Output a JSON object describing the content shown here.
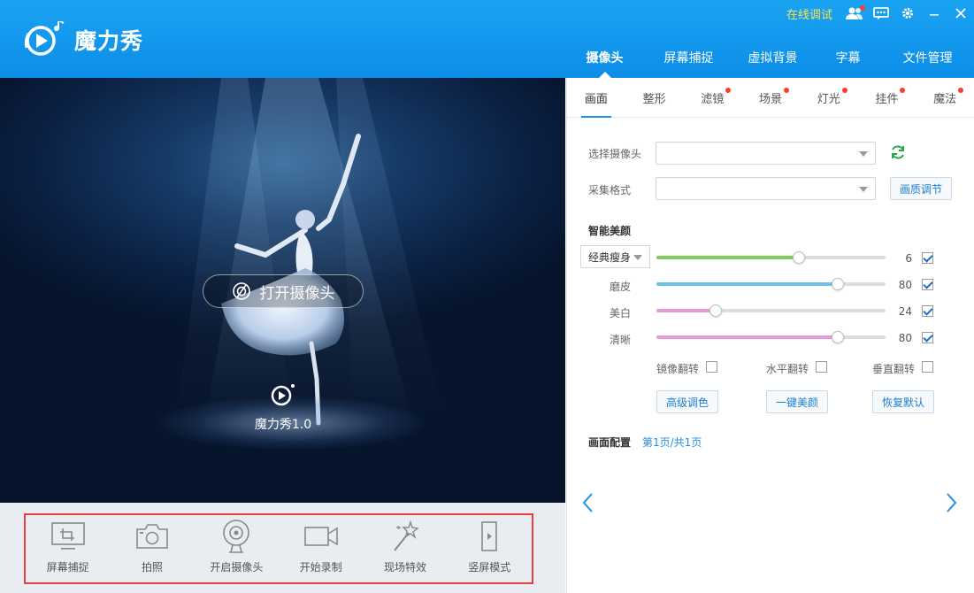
{
  "app": {
    "name": "魔力秀",
    "watermark_text": "魔力秀1.0",
    "colors": {
      "header": "#0c8ee8",
      "accent": "#1d8fe8",
      "online_debug": "#ffe14d",
      "badge": "#ff3b30",
      "toolbar_border": "#e64040"
    }
  },
  "topbar": {
    "online_debug": "在线调试",
    "icons": [
      "user-group-icon",
      "message-icon",
      "gear-icon",
      "minimize-icon",
      "close-icon"
    ]
  },
  "main_tabs": [
    {
      "label": "摄像头",
      "active": true
    },
    {
      "label": "屏幕捕捉",
      "active": false
    },
    {
      "label": "虚拟背景",
      "active": false
    },
    {
      "label": "字幕",
      "active": false
    },
    {
      "label": "文件管理",
      "active": false
    }
  ],
  "preview": {
    "open_camera_label": "打开摄像头"
  },
  "toolbar": [
    {
      "label": "屏幕捕捉",
      "icon": "crop-icon"
    },
    {
      "label": "拍照",
      "icon": "camera-icon"
    },
    {
      "label": "开启摄像头",
      "icon": "webcam-icon"
    },
    {
      "label": "开始录制",
      "icon": "video-icon"
    },
    {
      "label": "现场特效",
      "icon": "magic-wand-icon"
    },
    {
      "label": "竖屏模式",
      "icon": "portrait-icon"
    }
  ],
  "sub_tabs": [
    {
      "label": "画面",
      "active": true,
      "badge": false
    },
    {
      "label": "整形",
      "active": false,
      "badge": false
    },
    {
      "label": "滤镜",
      "active": false,
      "badge": true
    },
    {
      "label": "场景",
      "active": false,
      "badge": true
    },
    {
      "label": "灯光",
      "active": false,
      "badge": true
    },
    {
      "label": "挂件",
      "active": false,
      "badge": true
    },
    {
      "label": "魔法",
      "active": false,
      "badge": true
    }
  ],
  "settings": {
    "select_camera_label": "选择摄像头",
    "camera_value": "",
    "capture_format_label": "采集格式",
    "format_value": "",
    "quality_button": "画质调节"
  },
  "beauty": {
    "title": "智能美颜",
    "preset": "经典瘦身",
    "sliders": [
      {
        "label": "",
        "value": 6,
        "level": 0.62,
        "color": "#7ccf5a",
        "checked": true
      },
      {
        "label": "磨皮",
        "value": 80,
        "level": 0.79,
        "color": "#6cc3e8",
        "checked": true
      },
      {
        "label": "美白",
        "value": 24,
        "level": 0.26,
        "color": "#e89ad8",
        "checked": true
      },
      {
        "label": "清晰",
        "value": 80,
        "level": 0.79,
        "color": "#e89ad8",
        "checked": true
      }
    ],
    "flips": [
      {
        "label": "镜像翻转",
        "checked": false
      },
      {
        "label": "水平翻转",
        "checked": false
      },
      {
        "label": "垂直翻转",
        "checked": false
      }
    ],
    "buttons": [
      "高级调色",
      "一键美颜",
      "恢复默认"
    ]
  },
  "picture_config": {
    "title": "画面配置",
    "page_info": "第1页/共1页"
  }
}
